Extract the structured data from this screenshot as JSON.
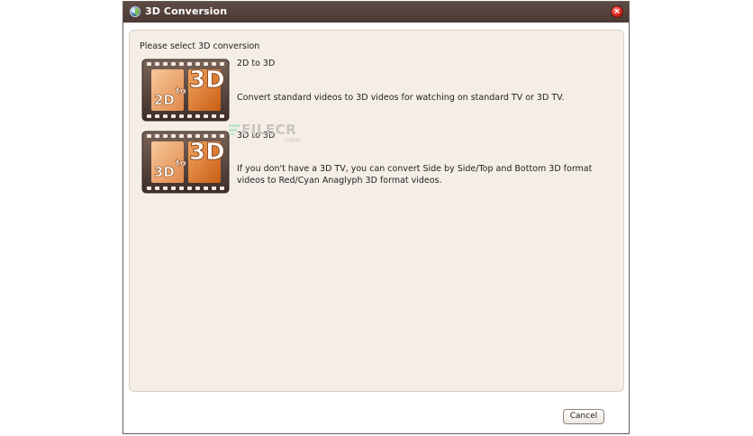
{
  "window": {
    "title": "3D Conversion",
    "close_glyph": "×"
  },
  "main": {
    "prompt": "Please select 3D conversion",
    "options": [
      {
        "title": "2D to 3D",
        "description": "Convert standard videos to 3D videos for watching on standard TV or 3D TV.",
        "icon": "2d-to-3d-icon",
        "thumb_from": "2D",
        "thumb_to": "3D",
        "thumb_word": "to"
      },
      {
        "title": "3D to 3D",
        "description": "If you don't have a 3D TV, you can convert Side by Side/Top and Bottom 3D format videos to Red/Cyan Anaglyph 3D format videos.",
        "icon": "3d-to-3d-icon",
        "thumb_from": "3D",
        "thumb_to": "3D",
        "thumb_word": "to"
      }
    ]
  },
  "watermark": {
    "text": "FILECR",
    "suffix": ".com"
  },
  "footer": {
    "cancel_label": "Cancel"
  },
  "colors": {
    "titlebar": "#4f3d38",
    "panel": "#f5eee7",
    "film": "#5a463e",
    "frame_orange": "#d96f1c"
  }
}
